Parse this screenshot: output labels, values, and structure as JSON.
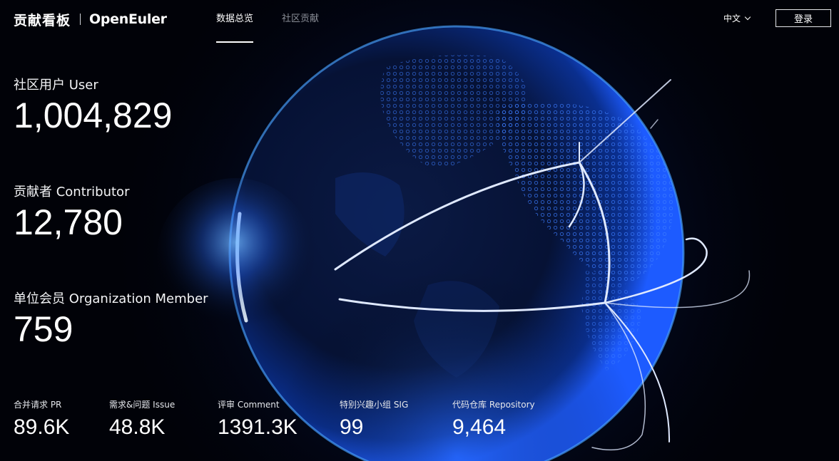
{
  "header": {
    "brand_title": "贡献看板",
    "brand_logo": "OpenEuler",
    "tabs": [
      {
        "label": "数据总览",
        "active": true
      },
      {
        "label": "社区贡献",
        "active": false
      }
    ],
    "language": "中文",
    "login_label": "登录"
  },
  "stats": [
    {
      "label": "社区用户 User",
      "value": "1,004,829"
    },
    {
      "label": "贡献者 Contributor",
      "value": "12,780"
    },
    {
      "label": "单位会员 Organization Member",
      "value": "759"
    }
  ],
  "small_stats": [
    {
      "label": "合并请求 PR",
      "value": "89.6K"
    },
    {
      "label": "需求&问题 Issue",
      "value": "48.8K"
    },
    {
      "label": "评审 Comment",
      "value": "1391.3K"
    },
    {
      "label": "特别兴趣小组 SIG",
      "value": "99"
    },
    {
      "label": "代码仓库 Repository",
      "value": "9,464"
    }
  ],
  "colors": {
    "background": "#000000",
    "globe_glow": "#1e5bff",
    "rim": "#4aa3ff",
    "arc": "#dfe9ff",
    "inactive_tab": "#8b8f98"
  },
  "icons": {
    "language_dropdown": "chevron-down-icon",
    "globe": "globe-illustration"
  }
}
